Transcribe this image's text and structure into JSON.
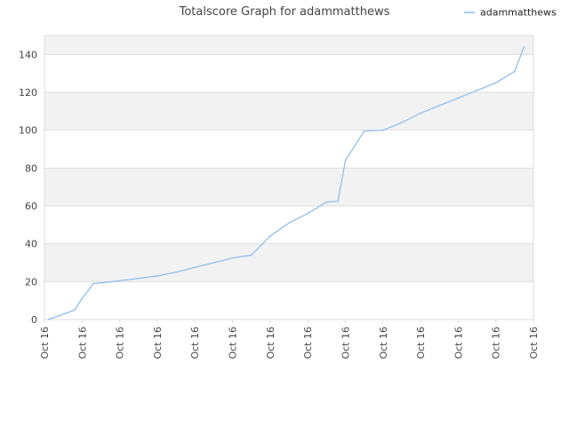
{
  "chart_data": {
    "type": "line",
    "title": "Totalscore Graph for adammatthews",
    "xlabel": "",
    "ylabel": "",
    "legend_position": "top-right",
    "grid": true,
    "ylim": [
      0,
      150
    ],
    "yticks": [
      0,
      20,
      40,
      60,
      80,
      100,
      120,
      140
    ],
    "x_tick_labels": [
      "Oct 16",
      "Oct 16",
      "Oct 16",
      "Oct 16",
      "Oct 16",
      "Oct 16",
      "Oct 16",
      "Oct 16",
      "Oct 16",
      "Oct 16",
      "Oct 16",
      "Oct 16",
      "Oct 16",
      "Oct 16"
    ],
    "colors": {
      "line": "#88bbee",
      "band": "#f2f2f2",
      "grid": "#dddddd"
    },
    "series": [
      {
        "name": "adammatthews",
        "x": [
          0.1,
          0.4,
          0.8,
          1.0,
          1.3,
          1.6,
          2.0,
          2.6,
          3.0,
          3.5,
          4.0,
          4.5,
          5.0,
          5.5,
          6.0,
          6.5,
          7.0,
          7.5,
          7.8,
          8.0,
          8.5,
          9.0,
          9.5,
          10.0,
          10.5,
          11.0,
          11.5,
          12.0,
          12.5,
          12.75
        ],
        "values": [
          0,
          2,
          5,
          11,
          19,
          19.5,
          20.5,
          22,
          23,
          25,
          27.5,
          30,
          32.5,
          34,
          44,
          51,
          56,
          62,
          62.5,
          84,
          99.5,
          100,
          104,
          109,
          113,
          117,
          121,
          125,
          131,
          144
        ]
      }
    ]
  }
}
